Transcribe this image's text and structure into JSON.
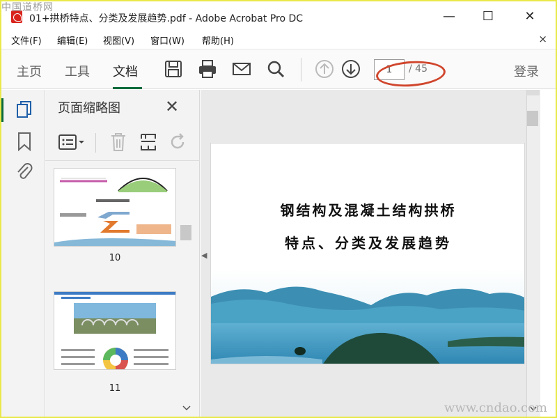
{
  "window": {
    "title": "01+拱桥特点、分类及发展趋势.pdf - Adobe Acrobat Pro DC",
    "minimize": "—",
    "maximize": "☐",
    "close": "✕"
  },
  "watermarks": {
    "top_left": "中国道桥网",
    "bottom_right": "www.cndao.com"
  },
  "menu": [
    "文件(F)",
    "编辑(E)",
    "视图(V)",
    "窗口(W)",
    "帮助(H)"
  ],
  "menu_close": "×",
  "toolbar": {
    "tabs": [
      "主页",
      "工具",
      "文档"
    ],
    "active_tab": "文档",
    "current_page": "1",
    "total_pages": "/ 45",
    "login": "登录"
  },
  "panel": {
    "title": "页面缩略图",
    "close": "✕",
    "thumbnails": [
      {
        "label": "10"
      },
      {
        "label": "11"
      }
    ]
  },
  "document": {
    "title_line1": "钢结构及混凝土结构拱桥",
    "title_line2": "特点、分类及发展趋势"
  },
  "colors": {
    "accent": "#0b6a3b",
    "oval": "#d0462d",
    "pdf_red": "#d9241c"
  }
}
